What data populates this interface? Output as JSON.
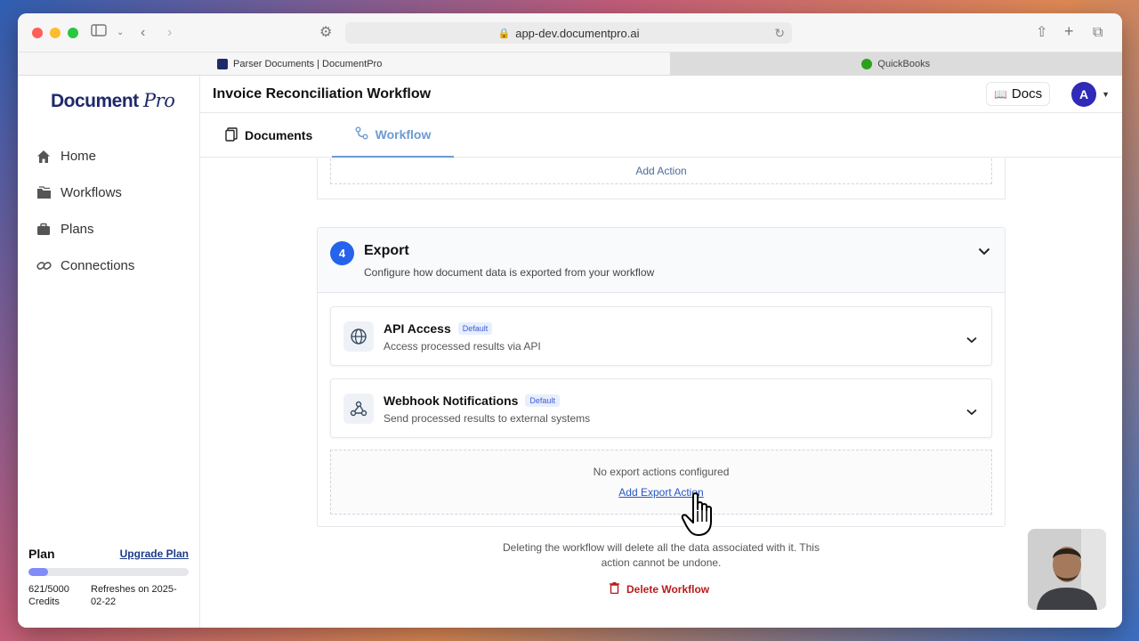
{
  "browser": {
    "url": "app-dev.documentpro.ai",
    "tabs": [
      {
        "label": "Parser Documents | DocumentPro",
        "icon": "documentpro-favicon"
      },
      {
        "label": "QuickBooks",
        "icon": "quickbooks-favicon"
      }
    ]
  },
  "sidebar": {
    "logo_main": "Document",
    "logo_accent": "Pro",
    "items": [
      {
        "label": "Home",
        "icon": "home-icon"
      },
      {
        "label": "Workflows",
        "icon": "folder-icon"
      },
      {
        "label": "Plans",
        "icon": "briefcase-icon"
      },
      {
        "label": "Connections",
        "icon": "link-icon"
      }
    ],
    "plan": {
      "title": "Plan",
      "upgrade_label": "Upgrade Plan",
      "credits_used": 621,
      "credits_total": 5000,
      "credits_label": "621/5000 Credits",
      "refresh_label": "Refreshes on 2025-02-22"
    }
  },
  "header": {
    "title": "Invoice Reconciliation Workflow",
    "docs_label": "Docs",
    "avatar_initial": "A"
  },
  "subtabs": {
    "documents": "Documents",
    "workflow": "Workflow"
  },
  "previous_section": {
    "add_action_label": "Add Action"
  },
  "export": {
    "step": "4",
    "title": "Export",
    "subtitle": "Configure how document data is exported from your workflow",
    "items": [
      {
        "title": "API Access",
        "badge": "Default",
        "subtitle": "Access processed results via API",
        "icon": "globe-icon"
      },
      {
        "title": "Webhook Notifications",
        "badge": "Default",
        "subtitle": "Send processed results to external systems",
        "icon": "webhook-icon"
      }
    ],
    "empty_text": "No export actions configured",
    "add_export_label": "Add Export Action"
  },
  "danger": {
    "warning": "Deleting the workflow will delete all the data associated with it. This action cannot be undone.",
    "delete_label": "Delete Workflow"
  },
  "colors": {
    "accent": "#2563eb",
    "tab_active": "#6b9bd2",
    "danger": "#b91c1c",
    "brand": "#1f2a6b"
  }
}
